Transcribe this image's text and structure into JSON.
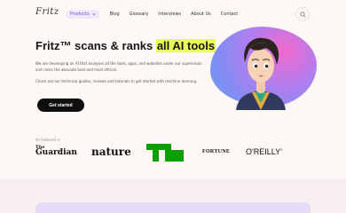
{
  "header": {
    "logo_text": "Fritz",
    "nav": [
      {
        "label": "Products",
        "active": true,
        "has_dropdown": true
      },
      {
        "label": "Blog"
      },
      {
        "label": "Glossary"
      },
      {
        "label": "Interviews"
      },
      {
        "label": "About Us"
      },
      {
        "label": "Contact"
      }
    ],
    "search_icon": "search-icon"
  },
  "hero": {
    "title_prefix": "Fritz™ scans & ranks ",
    "title_highlight": "all AI tools",
    "desc_line1": "We are developing an AI that analyses all the tools, apps, and websites under our supervision",
    "desc_line2": "and ranks the absolute best and most ethical.",
    "desc_line3": "Check out our technical guides, reviews and tutorials to get started with machine learning.",
    "cta_label": "Get started",
    "image": "person-portrait"
  },
  "featured": {
    "label": "As featured in",
    "brands": {
      "guardian_top": "The",
      "guardian_main": "Guardian",
      "nature": "nature",
      "techcrunch": "TechCrunch logo",
      "fortune": "FORTUNE",
      "oreilly": "O'REILLY",
      "oreilly_mark": "®"
    }
  },
  "colors": {
    "accent": "#6d55d9",
    "highlight": "#e9fb5b",
    "cta_bg": "#0f0f0f",
    "techcrunch_green": "#0a9e01",
    "background": "#fdf8f5"
  }
}
